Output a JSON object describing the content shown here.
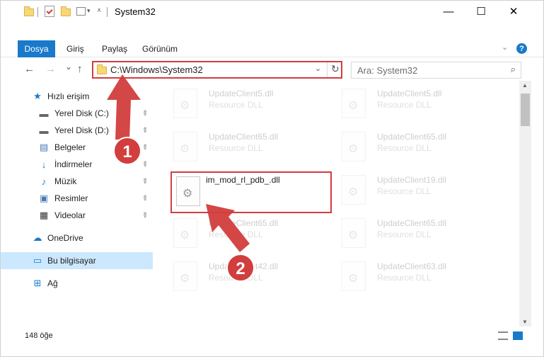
{
  "window": {
    "title": "System32",
    "minimize": "—",
    "maximize": "☐",
    "close": "✕"
  },
  "ribbon": {
    "tabs": [
      "Dosya",
      "Giriş",
      "Paylaş",
      "Görünüm"
    ],
    "help": "?"
  },
  "nav": {
    "back": "←",
    "forward": "→",
    "recent": "⌄",
    "up": "↑",
    "address": "C:\\Windows\\System32",
    "search_placeholder": "Ara: System32"
  },
  "sidebar": {
    "items": [
      {
        "label": "Hızlı erişim",
        "icon": "star-icon",
        "glyph": "★"
      },
      {
        "label": "Yerel Disk (C:)",
        "icon": "drive-icon",
        "glyph": "▬"
      },
      {
        "label": "Yerel Disk (D:)",
        "icon": "drive-icon",
        "glyph": "▬"
      },
      {
        "label": "Belgeler",
        "icon": "documents-icon",
        "glyph": "▤"
      },
      {
        "label": "İndirmeler",
        "icon": "downloads-icon",
        "glyph": "↓"
      },
      {
        "label": "Müzik",
        "icon": "music-icon",
        "glyph": "♪"
      },
      {
        "label": "Resimler",
        "icon": "pictures-icon",
        "glyph": "▣"
      },
      {
        "label": "Videolar",
        "icon": "videos-icon",
        "glyph": "▦"
      },
      {
        "label": "OneDrive",
        "icon": "cloud-icon",
        "glyph": "☁"
      },
      {
        "label": "Bu bilgisayar",
        "icon": "computer-icon",
        "glyph": "▭"
      },
      {
        "label": "Ağ",
        "icon": "network-icon",
        "glyph": "⊞"
      }
    ]
  },
  "files": [
    {
      "name": "UpdateClient5.dll",
      "desc": "Resource DLL"
    },
    {
      "name": "UpdateClient5.dll",
      "desc": "Resource DLL"
    },
    {
      "name": "UpdateClient65.dll",
      "desc": "Resource DLL"
    },
    {
      "name": "UpdateClient65.dll",
      "desc": "Resource DLL"
    },
    {
      "name": "im_mod_rl_pdb_.dll",
      "desc": ""
    },
    {
      "name": "UpdateClient19.dll",
      "desc": "Resource DLL"
    },
    {
      "name": "UpdateClient65.dll",
      "desc": "Resource DLL"
    },
    {
      "name": "UpdateClient65.dll",
      "desc": "Resource DLL"
    },
    {
      "name": "UpdateClient42.dll",
      "desc": "Resource DLL"
    },
    {
      "name": "UpdateClient63.dll",
      "desc": "Resource DLL"
    }
  ],
  "status": {
    "count": "148 öğe"
  },
  "annotations": {
    "badge1": "1",
    "badge2": "2",
    "color": "#d23d3d"
  }
}
